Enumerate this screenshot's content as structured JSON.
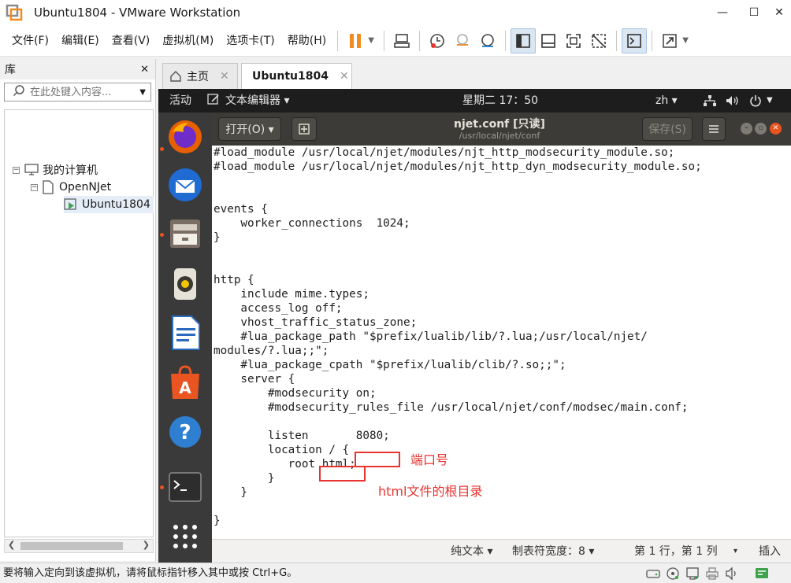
{
  "window": {
    "title": "Ubuntu1804 - VMware Workstation",
    "minimize": "—",
    "maximize": "☐",
    "close": "✕"
  },
  "menu": [
    "文件(F)",
    "编辑(E)",
    "查看(V)",
    "虚拟机(M)",
    "选项卡(T)",
    "帮助(H)"
  ],
  "library": {
    "title": "库",
    "close": "✕",
    "search_placeholder": "在此处键入内容...",
    "tree": {
      "root": "我的计算机",
      "folder": "OpenNJet",
      "vm": "Ubuntu1804"
    }
  },
  "tabs": [
    {
      "label": "主页"
    },
    {
      "label": "Ubuntu1804"
    }
  ],
  "gnome": {
    "activities": "活动",
    "app_menu": "文本编辑器 ▾",
    "clock": "星期二 17：50",
    "input_method": "zh ▾"
  },
  "gedit": {
    "open_label": "打开(O) ▾",
    "title": "njet.conf [只读]",
    "subtitle": "/usr/local/njet/conf",
    "save_label": "保存(S)",
    "code_lines": [
      "#load_module /usr/local/njet/modules/njt_http_modsecurity_module.so;",
      "#load_module /usr/local/njet/modules/njt_http_dyn_modsecurity_module.so;",
      "",
      "",
      "events {",
      "    worker_connections  1024;",
      "}",
      "",
      "",
      "http {",
      "    include mime.types;",
      "    access_log off;",
      "    vhost_traffic_status_zone;",
      "    #lua_package_path \"$prefix/lualib/lib/?.lua;/usr/local/njet/",
      "modules/?.lua;;\";",
      "    #lua_package_cpath \"$prefix/lualib/clib/?.so;;\";",
      "    server {",
      "        #modsecurity on;",
      "        #modsecurity_rules_file /usr/local/njet/conf/modsec/main.conf;",
      "",
      "        listen       8080;",
      "        location / {",
      "           root html;",
      "        }",
      "    }",
      "",
      "}"
    ],
    "annotations": {
      "port": "端口号",
      "root": "html文件的根目录"
    },
    "status": {
      "syntax": "纯文本 ▾",
      "tab_width": "制表符宽度：8 ▾",
      "position": "第 1 行，第 1 列",
      "position_arrow": "▾",
      "mode": "插入"
    }
  },
  "statusbar": {
    "message": "要将输入定向到该虚拟机，请将鼠标指针移入其中或按 Ctrl+G。"
  },
  "colors": {
    "accent_ubuntu": "#e95420",
    "highlight_red": "#e8332f",
    "vmware_pause": "#f28c1e"
  }
}
